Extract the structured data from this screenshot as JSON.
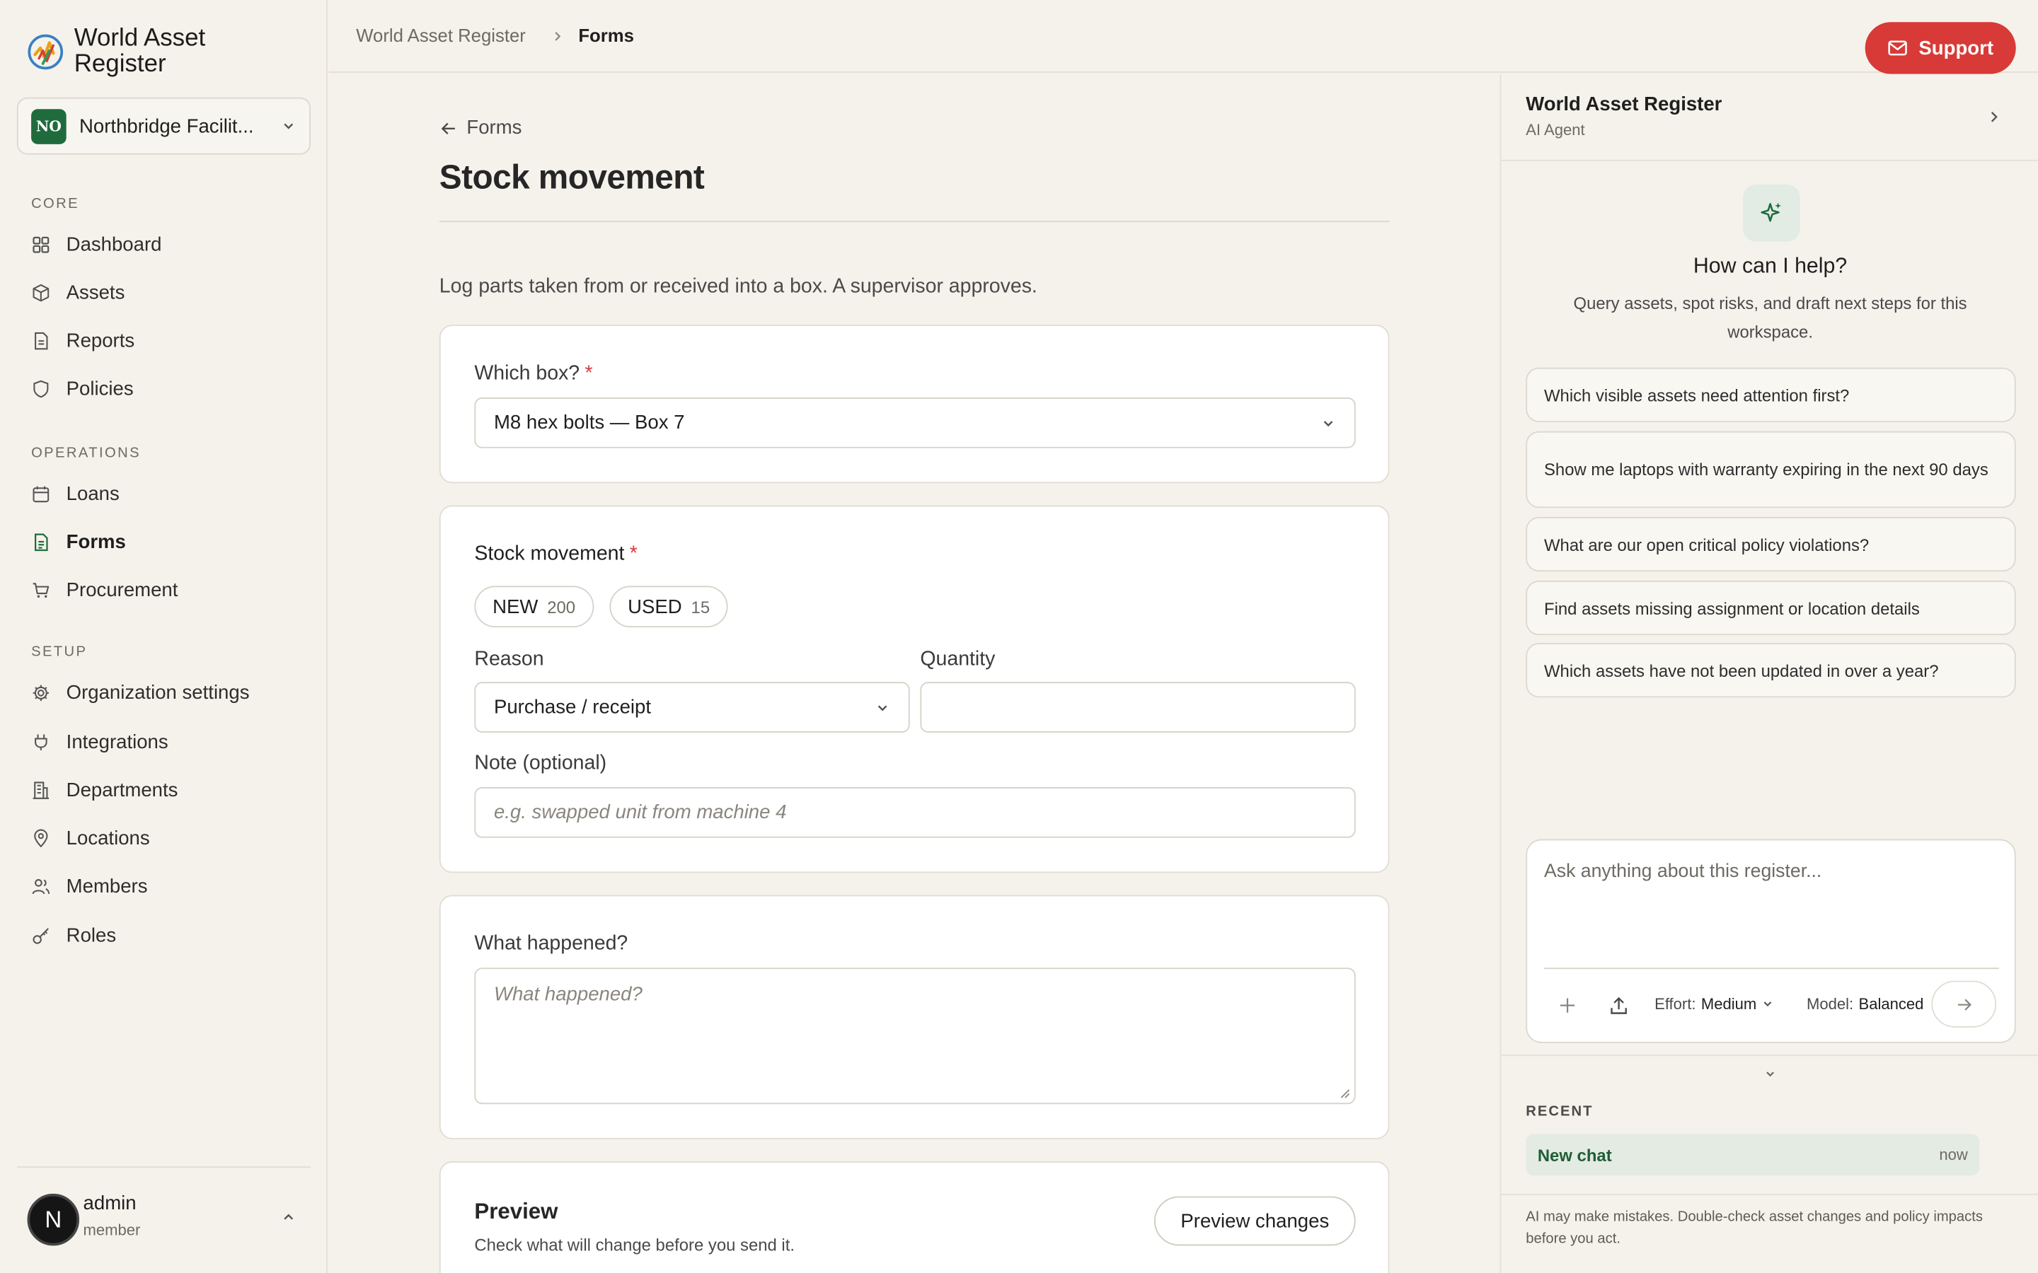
{
  "app": {
    "name": "World Asset Register"
  },
  "org": {
    "badge": "NO",
    "name": "Northbridge Facilit..."
  },
  "sidebar": {
    "sections": {
      "core": "CORE",
      "operations": "OPERATIONS",
      "setup": "SETUP"
    },
    "items": {
      "dashboard": "Dashboard",
      "assets": "Assets",
      "reports": "Reports",
      "policies": "Policies",
      "loans": "Loans",
      "forms": "Forms",
      "procurement": "Procurement",
      "org_settings": "Organization settings",
      "integrations": "Integrations",
      "departments": "Departments",
      "locations": "Locations",
      "members": "Members",
      "roles": "Roles"
    },
    "active": "Forms"
  },
  "user": {
    "initial": "N",
    "name": "admin",
    "role": "member"
  },
  "breadcrumb": {
    "root": "World Asset Register",
    "current": "Forms"
  },
  "support": {
    "label": "Support"
  },
  "form": {
    "back_label": "Forms",
    "title": "Stock movement",
    "intro": "Log parts taken from or received into a box. A supervisor approves.",
    "box": {
      "label": "Which box?",
      "required": "*",
      "value": "M8 hex bolts — Box 7"
    },
    "movement": {
      "label": "Stock movement",
      "required": "*",
      "pills": [
        {
          "label": "NEW",
          "count": "200"
        },
        {
          "label": "USED",
          "count": "15"
        }
      ],
      "reason_label": "Reason",
      "reason_value": "Purchase / receipt",
      "quantity_label": "Quantity",
      "quantity_value": "",
      "note_label": "Note (optional)",
      "note_placeholder": "e.g. swapped unit from machine 4"
    },
    "happened": {
      "label": "What happened?",
      "placeholder": "What happened?"
    },
    "preview": {
      "title": "Preview",
      "subtitle": "Check what will change before you send it.",
      "button": "Preview changes"
    }
  },
  "agent": {
    "title": "World Asset Register",
    "subtitle": "AI Agent",
    "help_title": "How can I help?",
    "help_sub": "Query assets, spot risks, and draft next steps for this workspace.",
    "suggestions": [
      "Which visible assets need attention first?",
      "Show me laptops with warranty expiring in the next 90 days",
      "What are our open critical policy violations?",
      "Find assets missing assignment or location details",
      "Which assets have not been updated in over a year?"
    ],
    "composer": {
      "placeholder": "Ask anything about this register...",
      "effort_label": "Effort:",
      "effort_value": "Medium",
      "model_label": "Model:",
      "model_value": "Balanced"
    },
    "recent": {
      "label": "RECENT",
      "items": [
        {
          "name": "New chat",
          "time": "now"
        }
      ]
    },
    "disclaimer": "AI may make mistakes. Double-check asset changes and policy impacts before you act."
  },
  "colors": {
    "accent": "#d83a37",
    "brand_green": "#1f6b3d",
    "background": "#f5f2eb"
  }
}
